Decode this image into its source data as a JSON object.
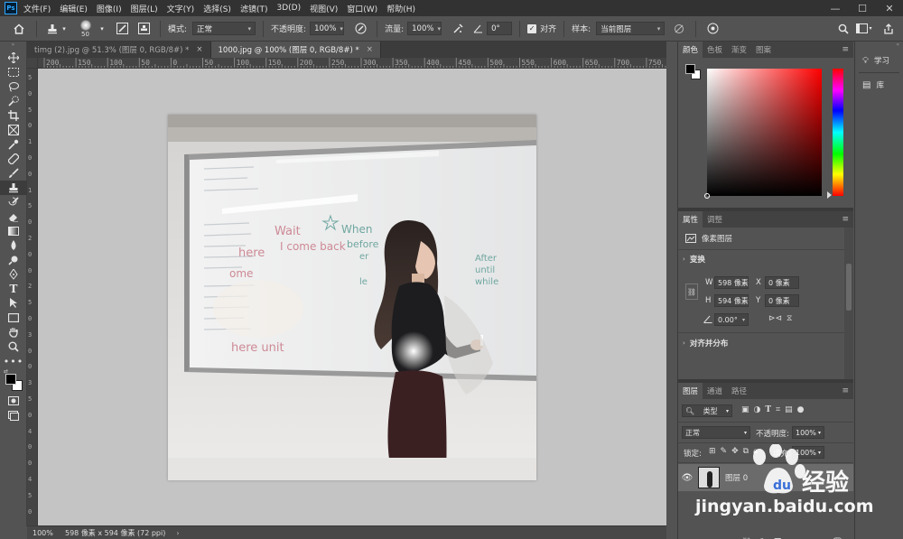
{
  "menubar": {
    "logo": "Ps",
    "items": [
      "文件(F)",
      "编辑(E)",
      "图像(I)",
      "图层(L)",
      "文字(Y)",
      "选择(S)",
      "滤镜(T)",
      "3D(D)",
      "视图(V)",
      "窗口(W)",
      "帮助(H)"
    ],
    "window_controls": [
      "minimize-icon",
      "maximize-icon",
      "close-icon"
    ]
  },
  "options": {
    "brush_size": "50",
    "mode_label": "模式:",
    "mode_value": "正常",
    "opacity_label": "不透明度:",
    "opacity_value": "100%",
    "flow_label": "流量:",
    "flow_value": "100%",
    "angle_value": "0°",
    "align_label": "对齐",
    "sample_label": "样本:",
    "sample_value": "当前图层"
  },
  "tabs": [
    {
      "label": "timg (2).jpg @ 51.3% (图层 0, RGB/8#) *",
      "active": false
    },
    {
      "label": "1000.jpg @ 100% (图层 0, RGB/8#) *",
      "active": true
    }
  ],
  "rulers": {
    "top": [
      "200",
      "150",
      "100",
      "50",
      "0",
      "50",
      "100",
      "150",
      "200",
      "250",
      "300",
      "350",
      "400",
      "450",
      "500",
      "550",
      "600",
      "650",
      "700",
      "750"
    ],
    "left": [
      "5",
      "0",
      "5",
      "0",
      "1",
      "0",
      "0",
      "1",
      "5",
      "0",
      "2",
      "0",
      "0",
      "2",
      "5",
      "0",
      "3",
      "0",
      "0",
      "3",
      "5",
      "0",
      "4",
      "0",
      "0",
      "4",
      "5",
      "0"
    ]
  },
  "photo": {
    "board_text": [
      "Wait",
      "When",
      "here",
      "I come back",
      "before",
      "ome",
      "After",
      "until",
      "while",
      "here unit",
      "er",
      "le"
    ]
  },
  "status": {
    "zoom": "100%",
    "doc_info": "598 像素 x 594 像素 (72 ppi)"
  },
  "color_panel": {
    "tabs": [
      "颜色",
      "色板",
      "渐变",
      "图案"
    ],
    "foreground": "#000000",
    "background": "#ffffff",
    "hue_color": "#ff0000"
  },
  "properties_panel": {
    "tabs": [
      "属性",
      "调整"
    ],
    "layer_type": "像素图层",
    "transform_title": "变换",
    "w_label": "W",
    "w_value": "598 像素",
    "h_label": "H",
    "h_value": "594 像素",
    "x_label": "X",
    "x_value": "0 像素",
    "y_label": "Y",
    "y_value": "0 像素",
    "angle_value": "0.00°",
    "align_title": "对齐并分布"
  },
  "layers_panel": {
    "tabs": [
      "图层",
      "通道",
      "路径"
    ],
    "filter_kind": "类型",
    "blend_mode": "正常",
    "opacity_label": "不透明度:",
    "opacity_value": "100%",
    "lock_label": "锁定:",
    "fill_label": "填充:",
    "fill_value": "100%",
    "layers": [
      {
        "name": "图层 0",
        "visible": true
      }
    ]
  },
  "right_buttons": [
    "学习",
    "库"
  ],
  "watermark": {
    "text": "经验",
    "url": "jingyan.baidu.com"
  }
}
